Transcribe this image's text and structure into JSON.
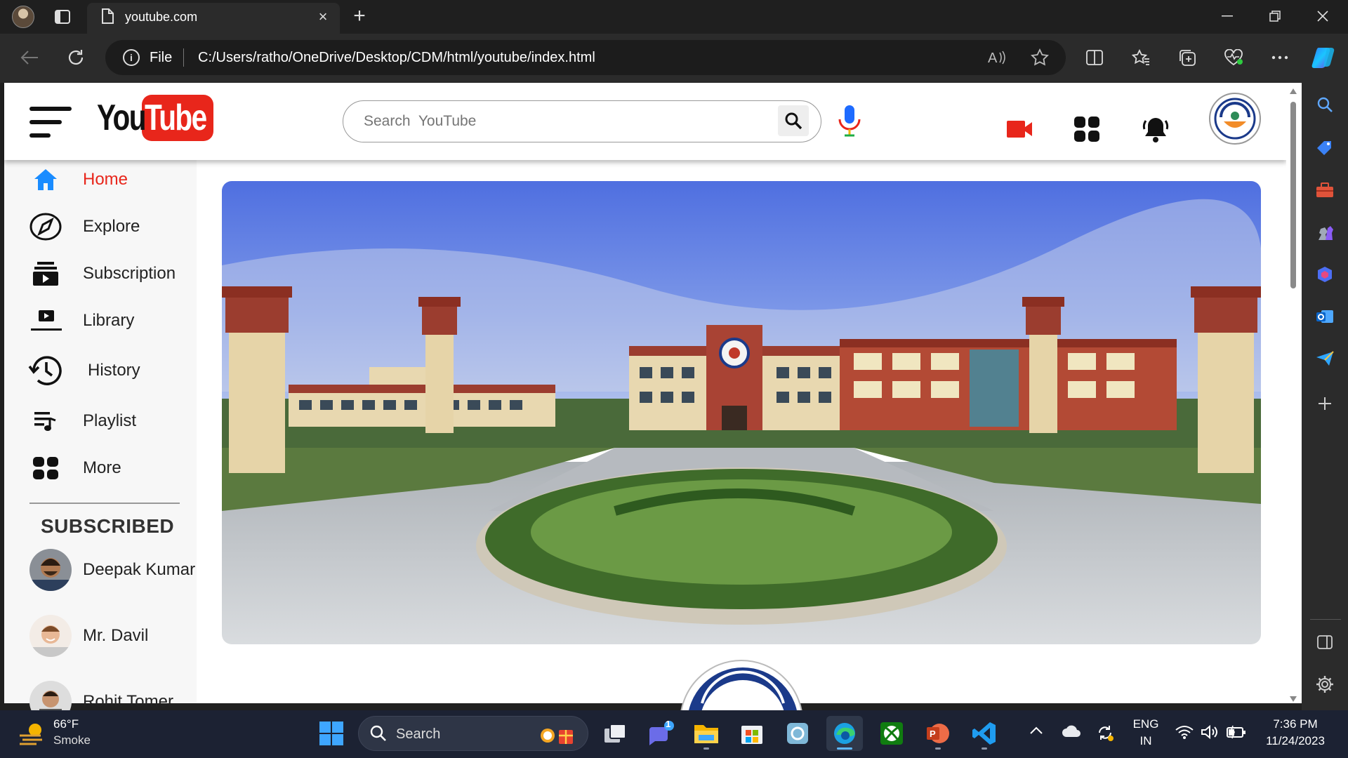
{
  "browser": {
    "tab_title": "youtube.com",
    "address_scheme": "File",
    "url": "C:/Users/ratho/OneDrive/Desktop/CDM/html/youtube/index.html"
  },
  "youtube": {
    "logo_you": "You",
    "logo_tube": "Tube",
    "search_placeholder": "Search  YouTube",
    "nav": [
      {
        "label": "Home",
        "icon": "home-icon",
        "active": true
      },
      {
        "label": "Explore",
        "icon": "compass-icon"
      },
      {
        "label": "Subscription",
        "icon": "subscriptions-icon"
      },
      {
        "label": "Library",
        "icon": "library-icon"
      },
      {
        "label": "History",
        "icon": "history-icon"
      },
      {
        "label": "Playlist",
        "icon": "playlist-icon"
      },
      {
        "label": "More",
        "icon": "grid-icon"
      }
    ],
    "subscribed_heading": "SUBSCRIBED",
    "subscriptions": [
      {
        "name": "Deepak Kumar"
      },
      {
        "name": "Mr. Davil"
      },
      {
        "name": "Rohit Tomer"
      }
    ],
    "colors": {
      "brand_red": "#e8261b",
      "active_nav": "#e8261b"
    }
  },
  "taskbar": {
    "weather_temp": "66°F",
    "weather_desc": "Smoke",
    "search_label": "Search",
    "chat_badge": "1",
    "lang_top": "ENG",
    "lang_bottom": "IN",
    "time": "7:36 PM",
    "date": "11/24/2023"
  }
}
